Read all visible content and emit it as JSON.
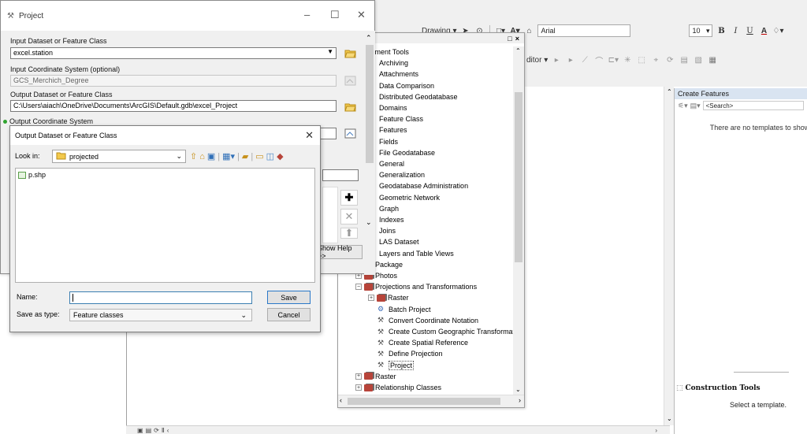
{
  "arcmap": {
    "toolbar": {
      "drawing_label": "Drawing ▾",
      "font_name": "Arial",
      "font_size": "10",
      "bold": "B",
      "italic": "I",
      "underline": "U",
      "font_color": "A",
      "editor_label": "ditor ▾"
    },
    "create_features": {
      "title": "Create Features",
      "search_placeholder": "<Search>",
      "no_templates": "There are no templates to show",
      "construction_title": "Construction Tools",
      "select_template": "Select a template."
    }
  },
  "project_dialog": {
    "title": "Project",
    "input_dataset_label": "Input Dataset or Feature Class",
    "input_dataset_value": "excel.station",
    "input_cs_label": "Input Coordinate System (optional)",
    "input_cs_value": "GCS_Merchich_Degree",
    "output_dataset_label": "Output Dataset or Feature Class",
    "output_dataset_value": "C:\\Users\\aiach\\OneDrive\\Documents\\ArcGIS\\Default.gdb\\excel_Project",
    "output_cs_label": "Output Coordinate System",
    "show_help": "Show Help >>"
  },
  "save_dialog": {
    "title": "Output Dataset or Feature Class",
    "look_in_label": "Look in:",
    "look_in_value": "projected",
    "items": [
      "p.shp"
    ],
    "name_label": "Name:",
    "name_value": "",
    "save_as_type_label": "Save as type:",
    "save_as_type_value": "Feature classes",
    "save_button": "Save",
    "cancel_button": "Cancel"
  },
  "toolbox": {
    "items": [
      {
        "label": "ta Management Tools",
        "level": 0,
        "kind": "root"
      },
      {
        "label": "Archiving",
        "level": 1,
        "kind": "toolset"
      },
      {
        "label": "Attachments",
        "level": 1,
        "kind": "toolset"
      },
      {
        "label": "Data Comparison",
        "level": 1,
        "kind": "toolset"
      },
      {
        "label": "Distributed Geodatabase",
        "level": 1,
        "kind": "toolset"
      },
      {
        "label": "Domains",
        "level": 1,
        "kind": "toolset"
      },
      {
        "label": "Feature Class",
        "level": 1,
        "kind": "toolset"
      },
      {
        "label": "Features",
        "level": 1,
        "kind": "toolset"
      },
      {
        "label": "Fields",
        "level": 1,
        "kind": "toolset"
      },
      {
        "label": "File Geodatabase",
        "level": 1,
        "kind": "toolset"
      },
      {
        "label": "General",
        "level": 1,
        "kind": "toolset"
      },
      {
        "label": "Generalization",
        "level": 1,
        "kind": "toolset"
      },
      {
        "label": "Geodatabase Administration",
        "level": 1,
        "kind": "toolset"
      },
      {
        "label": "Geometric Network",
        "level": 1,
        "kind": "toolset"
      },
      {
        "label": "Graph",
        "level": 1,
        "kind": "toolset"
      },
      {
        "label": "Indexes",
        "level": 1,
        "kind": "toolset"
      },
      {
        "label": "Joins",
        "level": 1,
        "kind": "toolset"
      },
      {
        "label": "LAS Dataset",
        "level": 1,
        "kind": "toolset"
      },
      {
        "label": "Layers and Table Views",
        "level": 1,
        "kind": "toolset"
      },
      {
        "label": "Package",
        "level": 1,
        "kind": "toolset"
      },
      {
        "label": "Photos",
        "level": 1,
        "kind": "toolset"
      },
      {
        "label": "Projections and Transformations",
        "level": 1,
        "kind": "toolset-open"
      },
      {
        "label": "Raster",
        "level": 2,
        "kind": "toolset"
      },
      {
        "label": "Batch Project",
        "level": 2,
        "kind": "script"
      },
      {
        "label": "Convert Coordinate Notation",
        "level": 2,
        "kind": "tool"
      },
      {
        "label": "Create Custom Geographic Transformation",
        "level": 2,
        "kind": "tool"
      },
      {
        "label": "Create Spatial Reference",
        "level": 2,
        "kind": "tool"
      },
      {
        "label": "Define Projection",
        "level": 2,
        "kind": "tool"
      },
      {
        "label": "Project",
        "level": 2,
        "kind": "tool-selected"
      },
      {
        "label": "Raster",
        "level": 1,
        "kind": "toolset"
      },
      {
        "label": "Relationship Classes",
        "level": 1,
        "kind": "toolset"
      }
    ]
  }
}
